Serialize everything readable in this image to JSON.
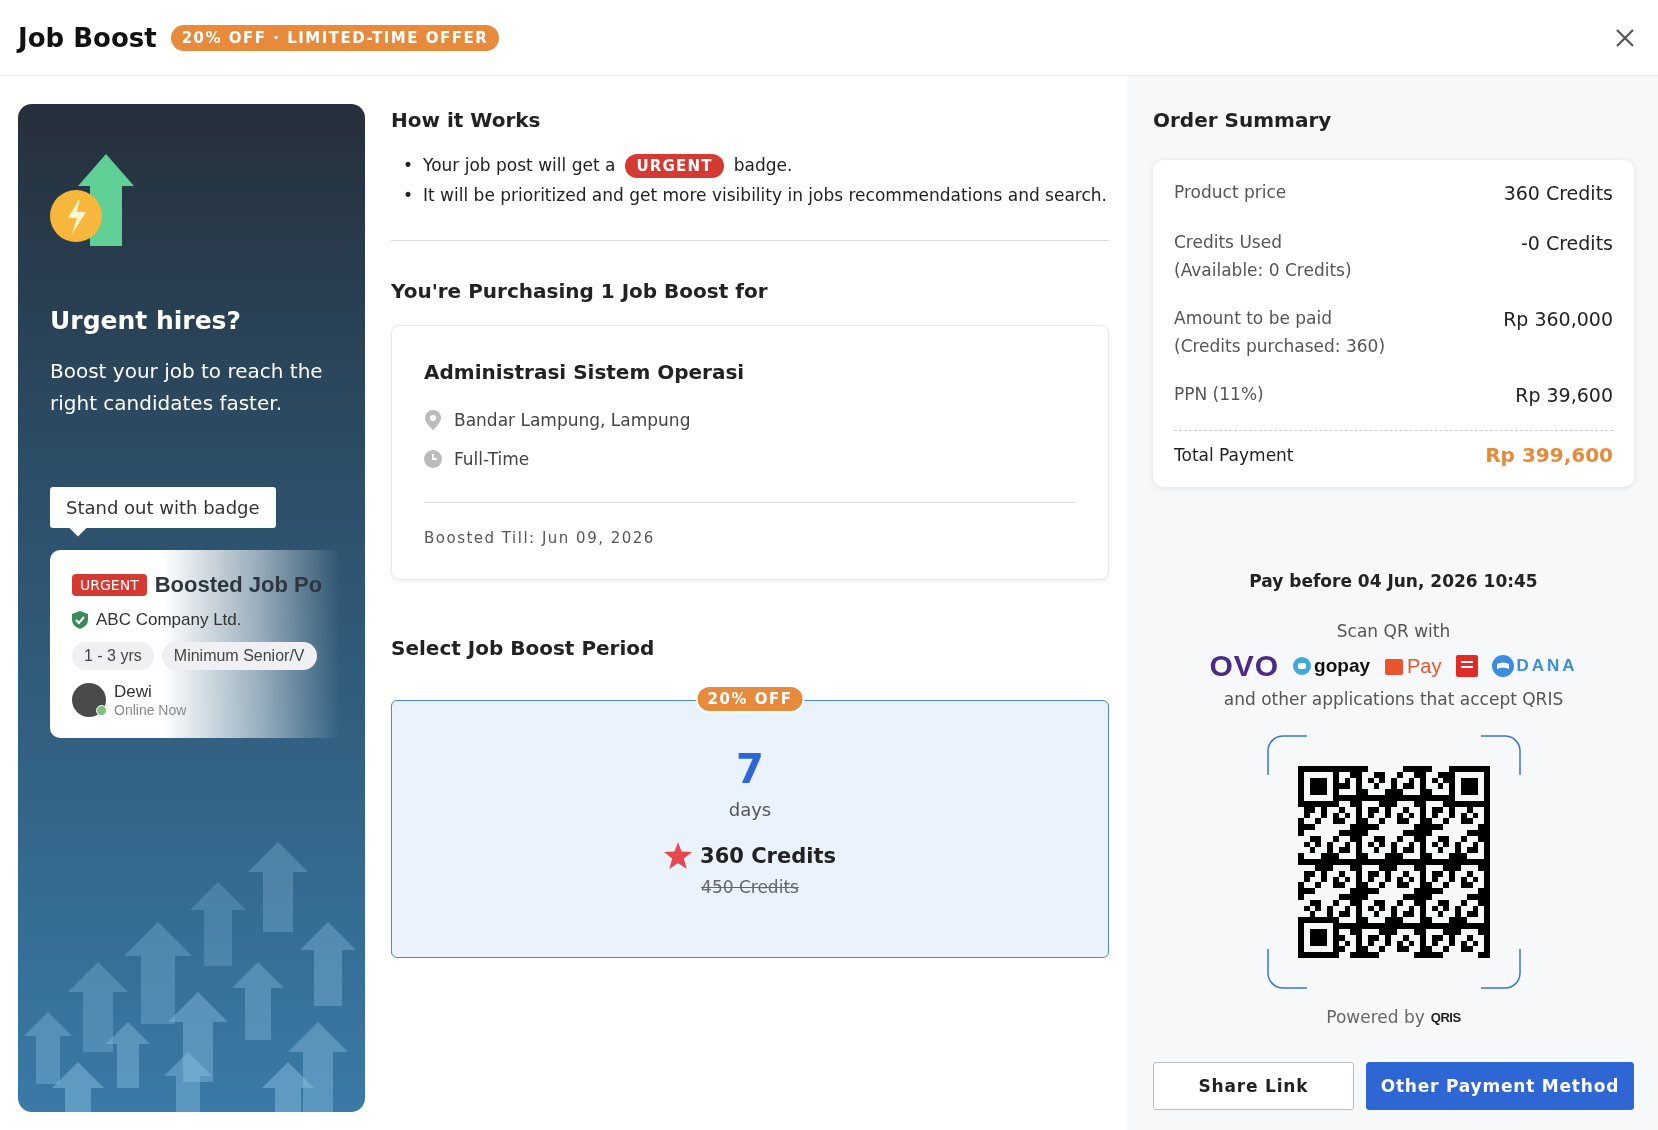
{
  "header": {
    "title": "Job Boost",
    "promo_badge": "20% OFF · LIMITED-TIME OFFER"
  },
  "promo_panel": {
    "heading": "Urgent hires?",
    "text": "Boost your job to reach the right candidates faster.",
    "tooltip": "Stand out with badge",
    "preview": {
      "badge": "URGENT",
      "title": "Boosted Job Po",
      "company": "ABC Company Ltd.",
      "tags": [
        "1 - 3 yrs",
        "Minimum Senior/V"
      ],
      "recruiter": "Dewi",
      "status": "Online Now"
    }
  },
  "how_it_works": {
    "title": "How it Works",
    "bullets": [
      {
        "marker": "•",
        "before": "Your job post will get a",
        "badge": "URGENT",
        "after": "badge."
      },
      {
        "marker": "•",
        "before": "It will be prioritized and get more visibility in jobs recommendations and search."
      }
    ]
  },
  "purchase": {
    "title": "You're Purchasing 1 Job Boost for",
    "job": {
      "title": "Administrasi Sistem Operasi",
      "location": "Bandar Lampung, Lampung",
      "type": "Full-Time",
      "boosted_till": "Boosted Till: Jun 09, 2026"
    }
  },
  "period": {
    "title": "Select Job Boost Period",
    "options": [
      {
        "badge": "20% OFF",
        "number": "7",
        "unit": "days",
        "price": "360 Credits",
        "old_price": "450 Credits",
        "selected": true
      }
    ]
  },
  "order_summary": {
    "title": "Order Summary",
    "rows": [
      {
        "label": "Product price",
        "value": "360 Credits"
      },
      {
        "label": "Credits Used",
        "sub": "(Available: 0 Credits)",
        "value": "-0 Credits"
      },
      {
        "label": "Amount to be paid",
        "sub": "(Credits purchased: 360)",
        "value": "Rp 360,000"
      },
      {
        "label": "PPN (11%)",
        "value": "Rp 39,600"
      }
    ],
    "total_label": "Total Payment",
    "total_value": "Rp 399,600"
  },
  "payment": {
    "deadline": "Pay before 04 Jun, 2026 10:45",
    "scan_label": "Scan QR with",
    "wallets": [
      {
        "kind": "ovo",
        "name": "OVO"
      },
      {
        "kind": "gopay",
        "name": "gopay"
      },
      {
        "kind": "shopeepay",
        "name": "Pay"
      },
      {
        "kind": "linkaja"
      },
      {
        "kind": "dana",
        "name": "DANA"
      }
    ],
    "others": "and other applications that accept QRIS",
    "powered_by": "Powered by",
    "powered_logo": "QRIS"
  },
  "buttons": [
    {
      "kind": "secondary",
      "label": "Share Link"
    },
    {
      "kind": "primary",
      "label": "Other Payment Method"
    }
  ]
}
